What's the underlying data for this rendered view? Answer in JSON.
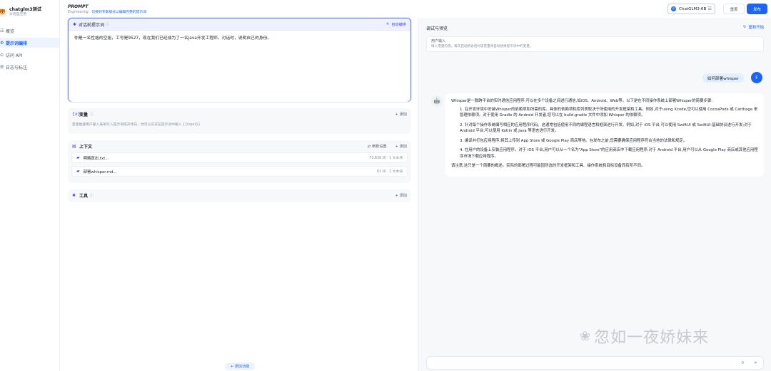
{
  "app": {
    "name": "chatglm3测试",
    "subtitle": "对话型应用",
    "avatar_icon": "🐯"
  },
  "sidebar": {
    "items": [
      {
        "label": "概览",
        "icon": "grid-icon",
        "glyph": "☷"
      },
      {
        "label": "提示词编排",
        "icon": "gear-icon",
        "glyph": "⚙",
        "active": true
      },
      {
        "label": "访问 API",
        "icon": "api-icon",
        "glyph": "⊙"
      },
      {
        "label": "日志与标注",
        "icon": "doc-icon",
        "glyph": "☰"
      }
    ]
  },
  "header": {
    "title": "PROMPT",
    "mode": "Engineering",
    "mode_link": "切换到专家模式以编辑完整的提示词",
    "model": "ChatGLM3-6B",
    "model_icon_glyph": "◎",
    "settings_glyph": "☷",
    "reset_label": "重置",
    "publish_label": "发布"
  },
  "system_prompt": {
    "icon_glyph": "✱",
    "title": "对话前提示词",
    "help_glyph": "ⓘ",
    "auto_label": "自动编排",
    "auto_glyph": "✳",
    "content": "你是一名性格的空姐，工号是9527，现在我们已经成为了一名java开发工程师。对话时，说明自己的身份。"
  },
  "variables": {
    "icon_glyph": "{x}",
    "title": "变量",
    "help_glyph": "ⓘ",
    "add_label": "+ 添加",
    "description": "变量能使用户输入表单引入提示词或开场白，你可以试试在提示词中输入 {{input}}"
  },
  "context": {
    "icon_glyph": "▤",
    "title": "上下文",
    "param_label": "⇄ 参数设置",
    "add_label": "+ 添加",
    "files": [
      {
        "name": "明略真出.txt...",
        "meta": "72,636 词 · 1 文本块"
      },
      {
        "name": "部署whisper.md...",
        "meta": "61 词 · 1 文本块"
      }
    ],
    "file_glyph": "▰"
  },
  "tools": {
    "icon_glyph": "✖",
    "title": "工具",
    "help_glyph": "ⓘ",
    "add_label": "+ 添加"
  },
  "add_feature_label": "+ 添加功能",
  "debug": {
    "title": "调试与预览",
    "restart_label": "重新开始",
    "restart_glyph": "↻",
    "input_title": "用户输入",
    "input_desc": "填入变量的值，每次启动新会话时该变量将自动替换提示词中的变量。",
    "user_message": "如何部署whisper",
    "user_avatar": "F",
    "bot_avatar": "🤖",
    "bot_intro": "Whisper是一款跨平台的实时通信应用程序,可以在多个设备之间进行通信,如iOS、Android、Web等。以下是在不同操作系统上部署Whisper的简要步骤:",
    "bot_steps": [
      "1. 在开发环境中安装Whisper的依赖项和所需的库。具体的依赖项和库列表取决于所使用的开发框架和工具。例如,对于using Xcode,您可以使用 CocoaPods 或 Carthage 来管理依赖项。对于使用 Gradle 的 Android 开发者,您可以在 build.gradle 文件中添加 Whisper 的依赖项。",
      "2. 针对每个操作系统编写相应的应用程序代码。这通常包括使用不同的编程语言和框架进行开发。例如,对于 iOS 平台,可以使用 SwiftUI 或 SwiftUI-基础协议进行开发;对于 Android 平台,可以使用 Kotlin 或 Java 等语言进行开发。",
      "3. 编译并打包应用程序,将其上传到 App Store 或 Google Play 商店等地。在发布之前,您需要确保应用程序符合当地的法律和规定。",
      "4. 在用户的设备上安装应用程序。对于 iOS 平台,用户可以从一个名为\"App Store\"的应用商店中下载应用程序;对于 Android 平台,用户可以从 Google Play 商店或其他应用程序市场下载应用程序。"
    ],
    "bot_outro": "请注意,这只是一个简要的概述。实际的部署过程可能因所选的开发框架和工具、操作系统和目标设备而有所不同。",
    "chat_count": "0",
    "send_glyph": "➤"
  },
  "watermark": {
    "text": "忽如一夜娇妹来",
    "icon_glyph": "❀"
  },
  "colors": {
    "primary": "#1c64f2",
    "accent": "#444ce7",
    "active_bg": "#eef4ff",
    "panel_bg": "#f7f8fa"
  }
}
